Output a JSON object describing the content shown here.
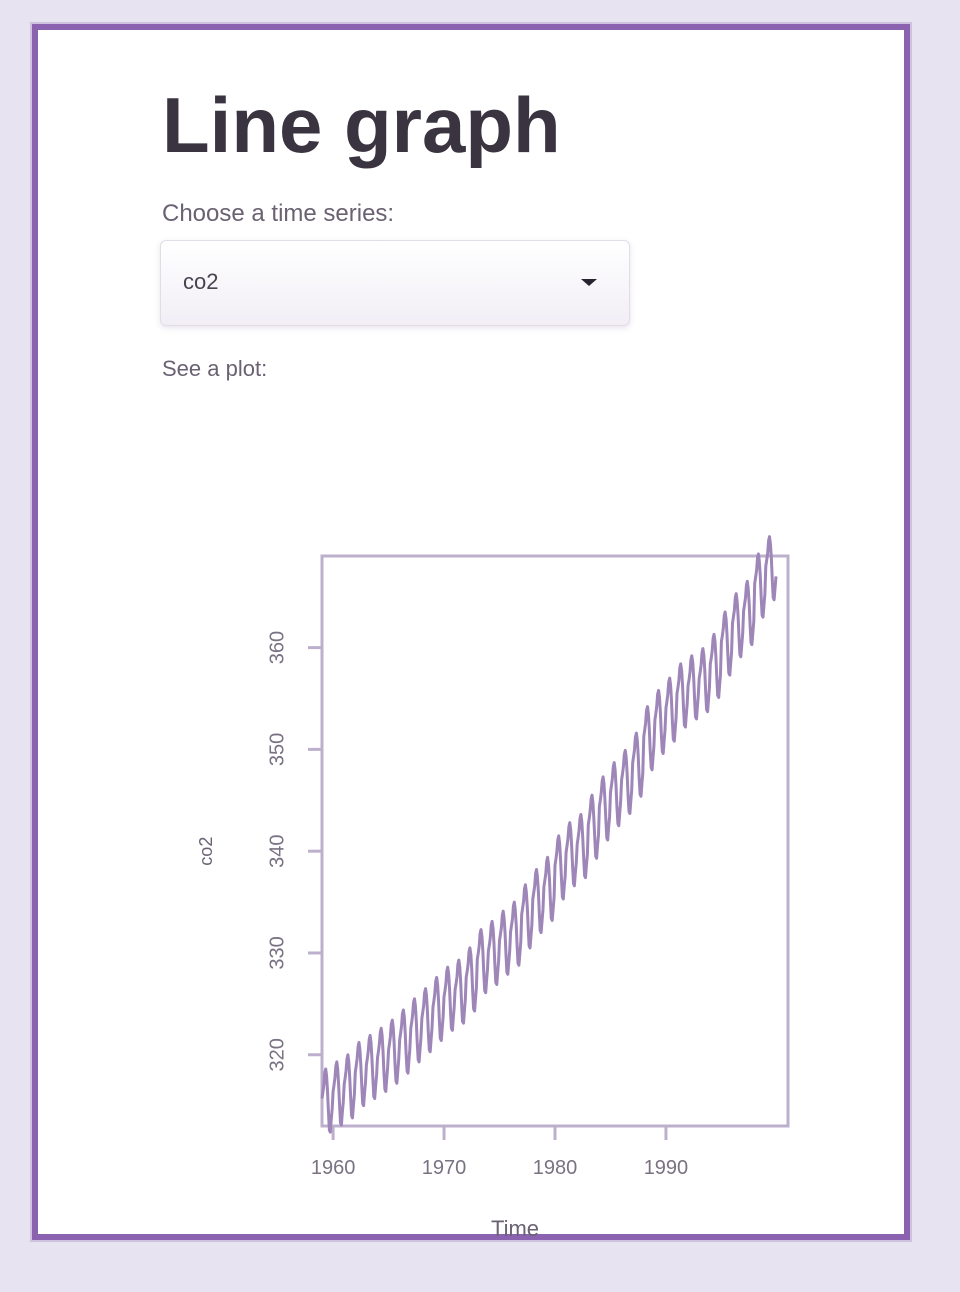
{
  "page": {
    "title": "Line graph",
    "select_label": "Choose a time series:",
    "select_value": "co2",
    "plot_label": "See a plot:"
  },
  "colors": {
    "frame_border": "#8a62b0",
    "background": "#e8e3f0",
    "line": "#9e86b8"
  },
  "icons": {
    "dropdown": "caret-down-icon"
  },
  "chart_data": {
    "type": "line",
    "title": "",
    "xlabel": "Time",
    "ylabel": "co2",
    "xlim": [
      1959,
      2001
    ],
    "ylim": [
      313,
      369
    ],
    "x_ticks": [
      1960,
      1970,
      1980,
      1990
    ],
    "y_ticks": [
      320,
      330,
      340,
      350,
      360
    ],
    "series": [
      {
        "start": 1959,
        "frequency": 12,
        "annual_means": [
          315.6,
          316.3,
          317.0,
          318.2,
          318.9,
          319.6,
          320.4,
          321.4,
          322.5,
          323.5,
          324.6,
          325.6,
          326.3,
          327.5,
          329.3,
          330.1,
          331.1,
          332.0,
          333.7,
          335.2,
          336.4,
          338.5,
          339.8,
          340.6,
          342.5,
          344.3,
          345.7,
          346.9,
          348.6,
          351.2,
          352.8,
          354.0,
          355.4,
          356.2,
          356.9,
          358.3,
          360.5,
          362.3,
          363.5,
          366.2,
          367.9
        ],
        "seasonal_cycle": [
          0.1,
          0.7,
          1.4,
          2.6,
          3.0,
          2.3,
          0.8,
          -1.3,
          -3.0,
          -3.2,
          -2.0,
          -0.9
        ]
      }
    ]
  }
}
